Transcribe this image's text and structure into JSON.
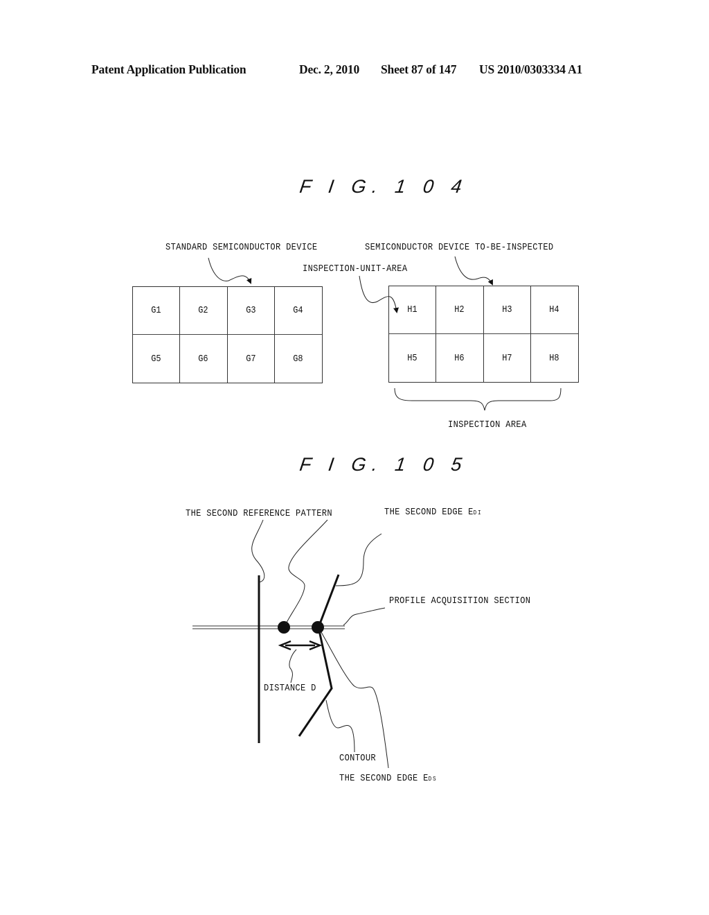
{
  "header": {
    "publication": "Patent Application Publication",
    "date": "Dec. 2, 2010",
    "sheet": "Sheet 87 of 147",
    "number": "US 2010/0303334 A1"
  },
  "fig104": {
    "title": "F I G. 1 0 4",
    "label_standard": "STANDARD SEMICONDUCTOR DEVICE",
    "label_to_be_inspected": "SEMICONDUCTOR DEVICE TO-BE-INSPECTED",
    "label_unit_area": "INSPECTION-UNIT-AREA",
    "label_inspection_area": "INSPECTION AREA",
    "standard_cells": [
      "G1",
      "G2",
      "G3",
      "G4",
      "G5",
      "G6",
      "G7",
      "G8"
    ],
    "inspected_cells": [
      "H1",
      "H2",
      "H3",
      "H4",
      "H5",
      "H6",
      "H7",
      "H8"
    ]
  },
  "fig105": {
    "title": "F I G. 1 0 5",
    "label_reference_pattern": "THE SECOND REFERENCE PATTERN",
    "label_edge_di": "THE SECOND EDGE E",
    "label_edge_di_sub": "DI",
    "label_profile_section": "PROFILE ACQUISITION SECTION",
    "label_distance": "DISTANCE D",
    "label_contour": "CONTOUR",
    "label_edge_ds": "THE SECOND EDGE E",
    "label_edge_ds_sub": "DS"
  }
}
